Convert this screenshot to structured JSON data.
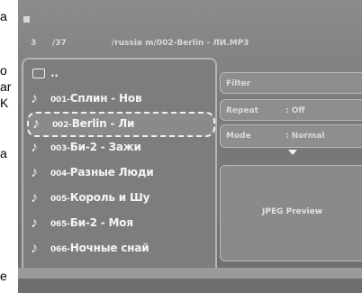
{
  "left_strip": {
    "lines": [
      "a",
      "o",
      "ar",
      "K",
      "a",
      "e"
    ]
  },
  "header": {
    "index": "3",
    "total": "/37",
    "path": "/russia m/002-Berlin - ЛИ.MP3"
  },
  "file_list": {
    "items": [
      {
        "icon": "folder-up-icon",
        "label": ".."
      },
      {
        "icon": "music-note-icon",
        "num": "001-",
        "label": "Сплин - Нов"
      },
      {
        "icon": "music-note-icon",
        "num": "002-",
        "label": "Berlin - Ли",
        "selected": true
      },
      {
        "icon": "music-note-icon",
        "num": "003-",
        "label": "Би-2 - Зажи"
      },
      {
        "icon": "music-note-icon",
        "num": "004-",
        "label": "Разные Люди"
      },
      {
        "icon": "music-note-icon",
        "num": "005-",
        "label": "Король и Шу"
      },
      {
        "icon": "music-note-icon",
        "num": "065-",
        "label": "Би-2 - Моя"
      },
      {
        "icon": "music-note-icon",
        "num": "066-",
        "label": "Ночные снай"
      }
    ]
  },
  "options": {
    "filter_label": "Filter",
    "repeat_label": "Repeat",
    "repeat_value": ": Off",
    "mode_label": "Mode",
    "mode_value": ": Normal"
  },
  "preview": {
    "label": "JPEG Preview"
  }
}
